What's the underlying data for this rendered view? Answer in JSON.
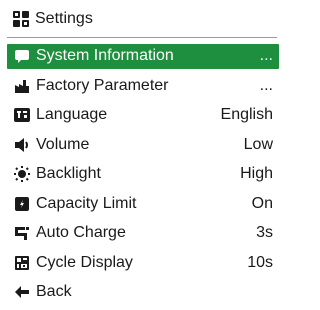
{
  "header": {
    "title": "Settings",
    "icon": "settings-grid-icon"
  },
  "colors": {
    "selected_background": "#1d8f3f",
    "text": "#1a1a1a"
  },
  "menu": {
    "items": [
      {
        "label": "System Information",
        "value": "...",
        "icon": "system-info-icon",
        "selected": true
      },
      {
        "label": "Factory Parameter",
        "value": "...",
        "icon": "factory-icon",
        "selected": false
      },
      {
        "label": "Language",
        "value": "English",
        "icon": "language-icon",
        "selected": false
      },
      {
        "label": "Volume",
        "value": "Low",
        "icon": "speaker-icon",
        "selected": false
      },
      {
        "label": "Backlight",
        "value": "High",
        "icon": "sun-icon",
        "selected": false
      },
      {
        "label": "Capacity Limit",
        "value": "On",
        "icon": "capacity-icon",
        "selected": false
      },
      {
        "label": "Auto Charge",
        "value": "3s",
        "icon": "charge-icon",
        "selected": false
      },
      {
        "label": "Cycle Display",
        "value": "10s",
        "icon": "cycle-display-icon",
        "selected": false
      },
      {
        "label": "Back",
        "value": "",
        "icon": "back-arrow-icon",
        "selected": false
      }
    ]
  }
}
